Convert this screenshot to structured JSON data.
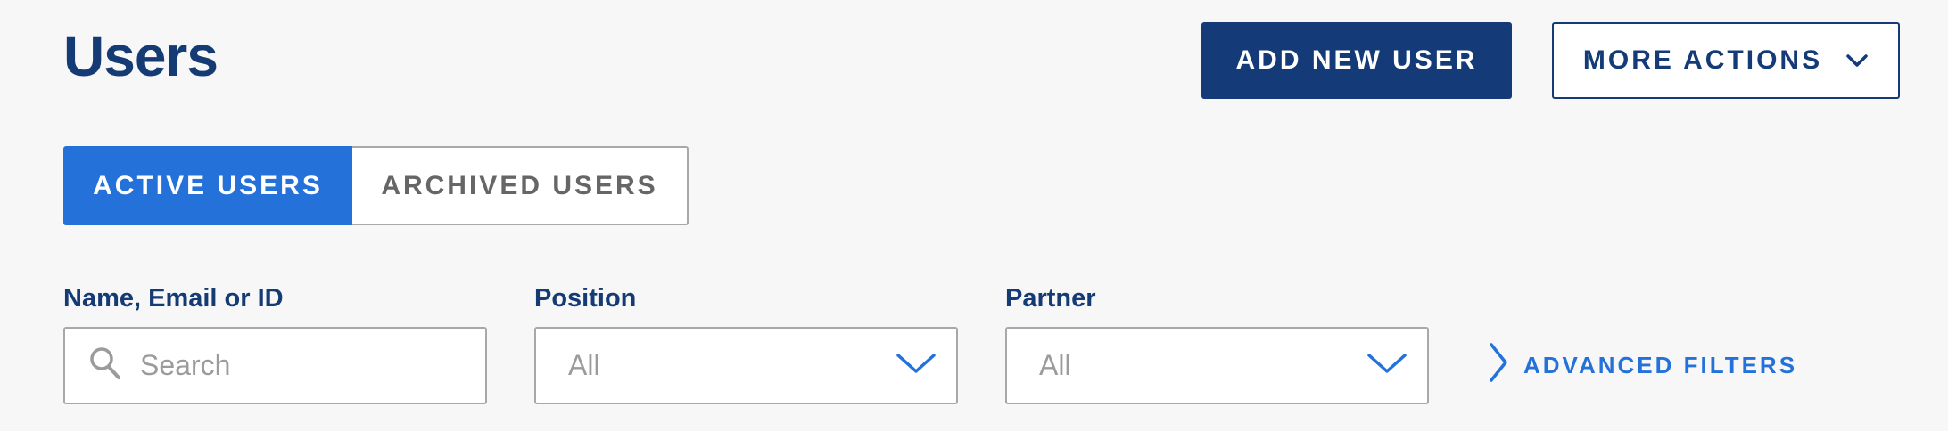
{
  "header": {
    "title": "Users",
    "add_user_label": "ADD NEW USER",
    "more_actions_label": "MORE ACTIONS"
  },
  "tabs": [
    {
      "label": "ACTIVE USERS",
      "active": true
    },
    {
      "label": "ARCHIVED USERS",
      "active": false
    }
  ],
  "filters": {
    "search": {
      "label": "Name, Email or ID",
      "placeholder": "Search",
      "value": "",
      "icon": "search-icon"
    },
    "position": {
      "label": "Position",
      "value": "All",
      "icon": "chevron-down-icon"
    },
    "partner": {
      "label": "Partner",
      "value": "All",
      "icon": "chevron-down-icon"
    },
    "advanced_label": "ADVANCED FILTERS",
    "advanced_icon": "chevron-right-icon"
  },
  "colors": {
    "brand_navy": "#143b78",
    "accent_blue": "#2472d9",
    "background": "#f7f7f8",
    "border_gray": "#a8a8a8",
    "placeholder_gray": "#9b9b9b"
  }
}
